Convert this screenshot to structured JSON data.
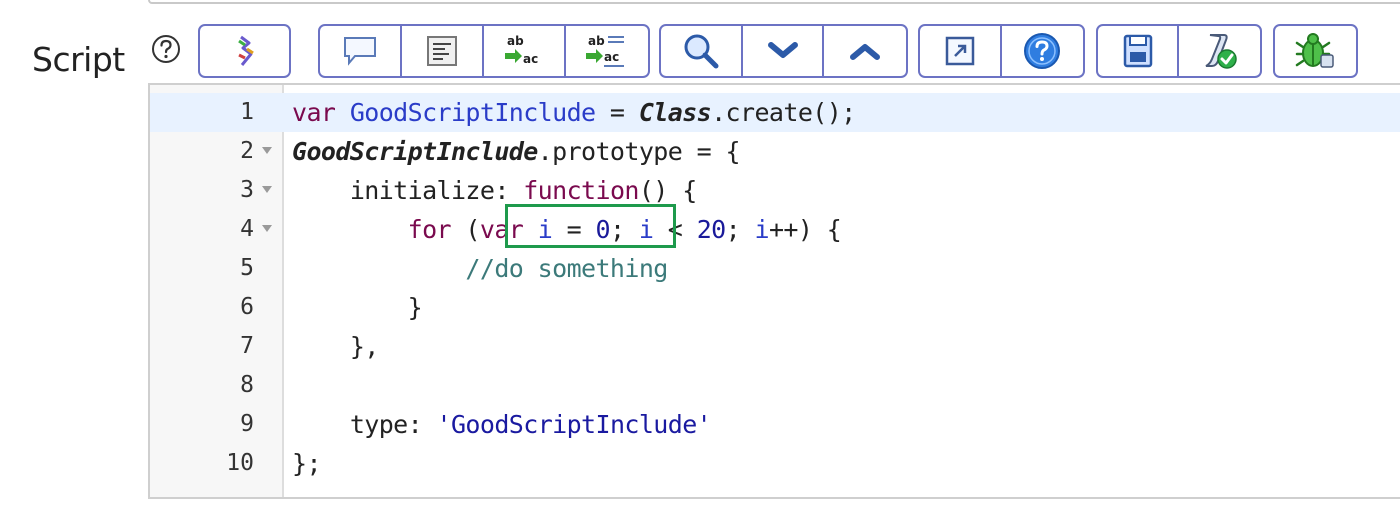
{
  "field": {
    "label": "Script"
  },
  "toolbar": {
    "groups": [
      {
        "buttons": [
          {
            "icon": "syntax-check-icon"
          }
        ]
      },
      {
        "buttons": [
          {
            "icon": "comment-icon"
          },
          {
            "icon": "format-code-icon"
          },
          {
            "icon": "replace-icon"
          },
          {
            "icon": "replace-all-icon"
          }
        ]
      },
      {
        "buttons": [
          {
            "icon": "search-icon"
          },
          {
            "icon": "chevron-down-icon"
          },
          {
            "icon": "chevron-up-icon"
          }
        ]
      },
      {
        "buttons": [
          {
            "icon": "fullscreen-icon"
          },
          {
            "icon": "help-icon"
          }
        ]
      },
      {
        "buttons": [
          {
            "icon": "save-icon"
          },
          {
            "icon": "script-validate-icon"
          }
        ]
      },
      {
        "buttons": [
          {
            "icon": "debug-icon"
          }
        ]
      }
    ]
  },
  "editor": {
    "line_numbers": [
      "1",
      "2",
      "3",
      "4",
      "5",
      "6",
      "7",
      "8",
      "9",
      "10"
    ],
    "tokens": {
      "l1_var": "var",
      "l1_name": "GoodScriptInclude",
      "l1_eq": " = ",
      "l1_class": "Class",
      "l1_rest": ".create();",
      "l2_name": "GoodScriptInclude",
      "l2_rest": ".prototype = {",
      "l3_indent": "    ",
      "l3_key": "initialize: ",
      "l3_func": "function",
      "l3_rest": "() {",
      "l4_indent": "        ",
      "l4_for": "for",
      "l4_paren": " (",
      "l4_var": "var",
      "l4_i1": "i",
      "l4_eq": " = ",
      "l4_zero": "0",
      "l4_semi": "; ",
      "l4_i2": "i",
      "l4_lt": " < ",
      "l4_twenty": "20",
      "l4_semi2": "; ",
      "l4_i3": "i",
      "l4_rest": "++) {",
      "l5_indent": "            ",
      "l5_comment": "//do something",
      "l6_indent": "        ",
      "l6_rest": "}",
      "l7_indent": "    ",
      "l7_rest": "},",
      "l9_indent": "    ",
      "l9_key": "type: ",
      "l9_str": "'GoodScriptInclude'",
      "l10_rest": "};"
    }
  },
  "colors": {
    "toolbar_border": "#6c73c4",
    "highlight_box": "#1e9a4c",
    "active_line": "#e8f2ff"
  }
}
